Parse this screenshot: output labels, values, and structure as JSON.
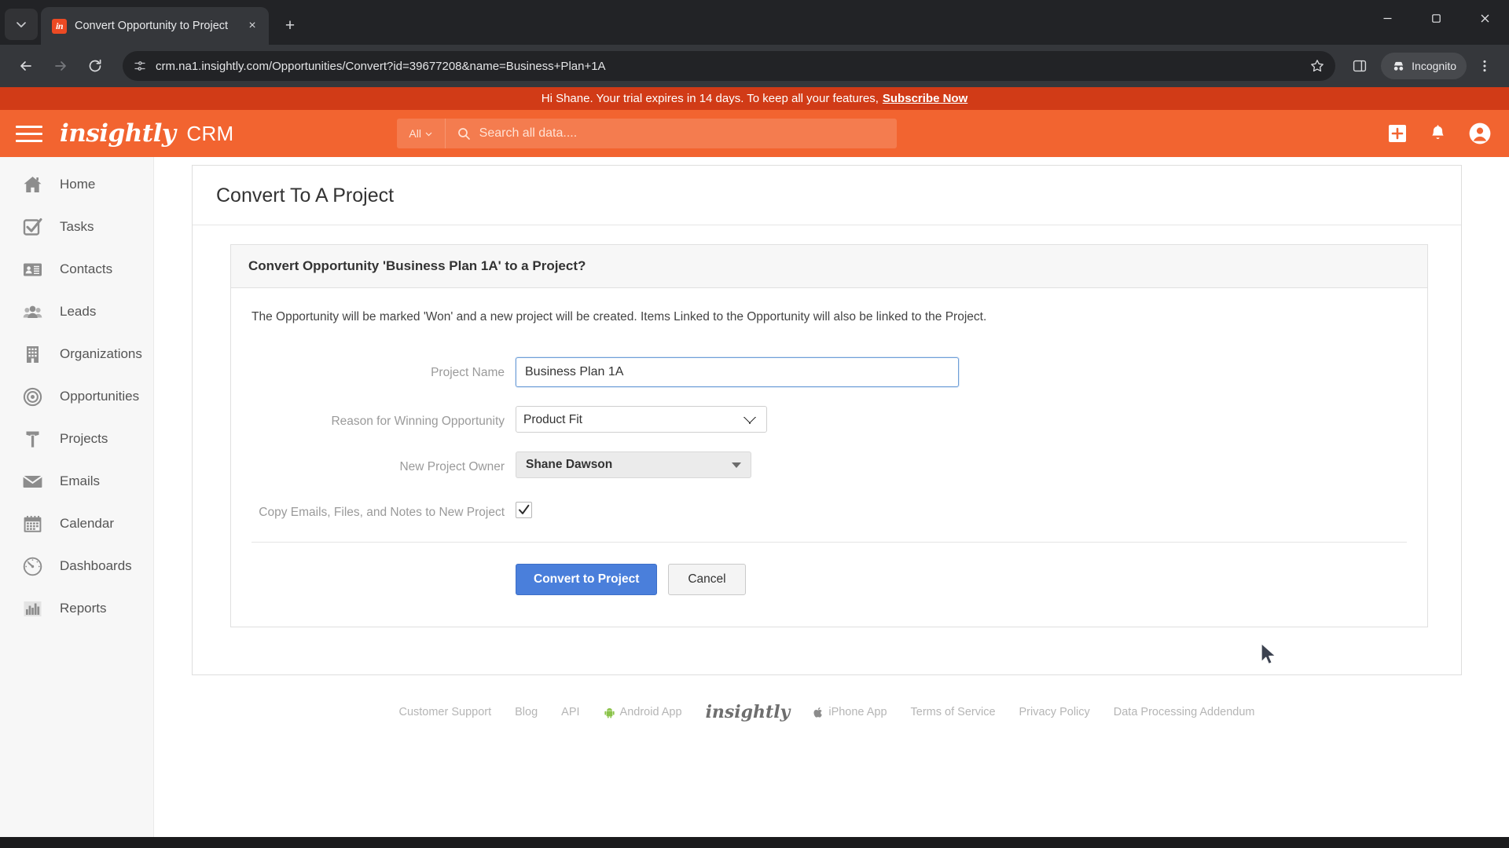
{
  "browser": {
    "tab": {
      "title": "Convert Opportunity to Project",
      "favicon_letters": "in"
    },
    "tab_list_icon": "chevron-down-icon",
    "new_tab_label": "+",
    "close_label": "×",
    "window_controls": {
      "minimize": "—",
      "maximize": "□",
      "close": "✕"
    },
    "nav": {
      "back": "←",
      "forward": "→",
      "reload": "⟳"
    },
    "url": "crm.na1.insightly.com/Opportunities/Convert?id=39677208&name=Business+Plan+1A",
    "incognito_label": "Incognito",
    "star_icon": "bookmark-star-icon",
    "side_panel_icon": "side-panel-icon",
    "menu_icon": "three-dot-menu-icon"
  },
  "banner": {
    "message": "Hi Shane. Your trial expires in 14 days. To keep all your features,",
    "cta": "Subscribe Now"
  },
  "header": {
    "logo": "insightly",
    "product": "CRM",
    "search": {
      "scope": "All",
      "placeholder": "Search all data...."
    },
    "add_icon": "plus-square-icon",
    "bell_icon": "bell-icon",
    "avatar_icon": "user-avatar-icon"
  },
  "sidebar": {
    "items": [
      {
        "label": "Home",
        "icon": "home-icon"
      },
      {
        "label": "Tasks",
        "icon": "checkbox-check-icon"
      },
      {
        "label": "Contacts",
        "icon": "contact-card-icon"
      },
      {
        "label": "Leads",
        "icon": "people-group-icon"
      },
      {
        "label": "Organizations",
        "icon": "building-icon"
      },
      {
        "label": "Opportunities",
        "icon": "target-icon"
      },
      {
        "label": "Projects",
        "icon": "hammer-icon"
      },
      {
        "label": "Emails",
        "icon": "envelope-icon"
      },
      {
        "label": "Calendar",
        "icon": "calendar-icon"
      },
      {
        "label": "Dashboards",
        "icon": "gauge-icon"
      },
      {
        "label": "Reports",
        "icon": "bar-chart-icon"
      }
    ]
  },
  "page": {
    "title": "Convert To A Project",
    "card_heading": "Convert Opportunity 'Business Plan 1A' to a Project?",
    "description": "The Opportunity will be marked 'Won' and a new project will be created. Items Linked to the Opportunity will also be linked to the Project.",
    "fields": {
      "project_name": {
        "label": "Project Name",
        "value": "Business Plan 1A"
      },
      "reason": {
        "label": "Reason for Winning Opportunity",
        "value": "Product Fit"
      },
      "owner": {
        "label": "New Project Owner",
        "value": "Shane Dawson"
      },
      "copy_items": {
        "label": "Copy Emails, Files, and Notes to New Project",
        "checked": true
      }
    },
    "buttons": {
      "primary": "Convert to Project",
      "secondary": "Cancel"
    }
  },
  "footer": {
    "links": [
      "Customer Support",
      "Blog",
      "API",
      "Android App",
      "iPhone App",
      "Terms of Service",
      "Privacy Policy",
      "Data Processing Addendum"
    ],
    "logo": "insightly"
  },
  "colors": {
    "brand_orange": "#f26430",
    "banner_red": "#d13b17",
    "primary_button": "#4a7fdb",
    "focus_border": "#6f9fd8"
  }
}
